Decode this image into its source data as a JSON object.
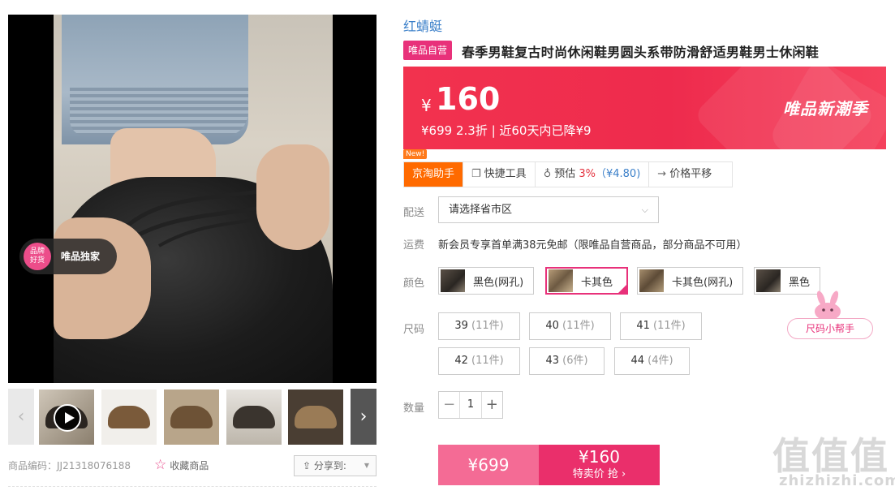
{
  "gallery": {
    "exclusive_badge_circle": "品牌\n好货",
    "exclusive_badge_text": "唯品独家",
    "prev_arrow": "‹",
    "next_arrow": "›",
    "thumbnails": 6
  },
  "footer": {
    "sku_code": "商品编码：JJ21318076188",
    "favorite_label": "收藏商品",
    "share_label": "分享到:"
  },
  "product": {
    "brand": "红蜻蜓",
    "vip_tag": "唯品自营",
    "title": "春季男鞋复古时尚休闲鞋男圆头系带防滑舒适男鞋男士休闲鞋"
  },
  "price": {
    "currency": "¥",
    "value": "160",
    "sub": "¥699 2.3折 | 近60天内已降¥9",
    "season_banner": "唯品新潮季"
  },
  "helper": {
    "new_tag": "New!",
    "tabs": [
      {
        "label": "京淘助手"
      },
      {
        "label": "快捷工具"
      },
      {
        "label_prefix": "预估 ",
        "percent": "3%",
        "amount": "（¥4.80)"
      },
      {
        "label": "价格平移"
      }
    ]
  },
  "delivery": {
    "label": "配送",
    "select_value": "请选择省市区"
  },
  "shipping": {
    "label": "运费",
    "text": "新会员专享首单满38元免邮（限唯品自营商品，部分商品不可用）"
  },
  "colors": {
    "label": "颜色",
    "options": [
      "黑色(网孔)",
      "卡其色",
      "卡其色(网孔)",
      "黑色"
    ],
    "selected_index": 1
  },
  "sizes": {
    "label": "尺码",
    "options": [
      {
        "size": "39",
        "stock": "(11件)"
      },
      {
        "size": "40",
        "stock": "(11件)"
      },
      {
        "size": "41",
        "stock": "(11件)"
      },
      {
        "size": "42",
        "stock": "(11件)"
      },
      {
        "size": "43",
        "stock": "(6件)"
      },
      {
        "size": "44",
        "stock": "(4件)"
      }
    ],
    "helper_label": "尺码小帮手"
  },
  "quantity": {
    "label": "数量",
    "value": "1",
    "minus": "−",
    "plus": "+"
  },
  "buy": {
    "original_price": "¥699",
    "special_price": "¥160",
    "special_label": "特卖价 抢 ›"
  },
  "watermark": {
    "text": "值值值",
    "url": "zhizhizhi.com"
  },
  "colors_hex": {
    "accent_pink": "#e8317a",
    "price_red": "#f2324e",
    "helper_orange": "#ff6a00",
    "brand_blue": "#3a7fc9"
  }
}
